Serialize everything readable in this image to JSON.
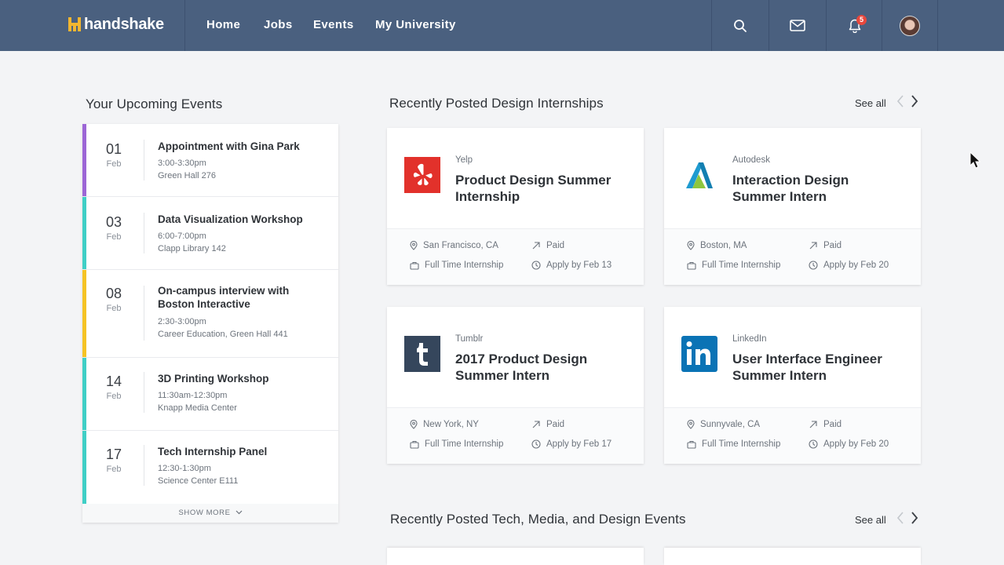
{
  "nav": {
    "brand": "handshake",
    "links": [
      "Home",
      "Jobs",
      "Events",
      "My University"
    ],
    "notification_count": "5",
    "icons": [
      "search-icon",
      "mail-icon",
      "bell-icon",
      "avatar"
    ]
  },
  "upcoming": {
    "title": "Your Upcoming Events",
    "events": [
      {
        "day": "01",
        "month": "Feb",
        "title": "Appointment with Gina Park",
        "time": "3:00-3:30pm",
        "location": "Green Hall 276",
        "color": "#9c66d6"
      },
      {
        "day": "03",
        "month": "Feb",
        "title": "Data Visualization Workshop",
        "time": "6:00-7:00pm",
        "location": "Clapp Library 142",
        "color": "#3fcfc6"
      },
      {
        "day": "08",
        "month": "Feb",
        "title": "On-campus interview with Boston Interactive",
        "time": "2:30-3:00pm",
        "location": "Career Education, Green Hall 441",
        "color": "#f5c324"
      },
      {
        "day": "14",
        "month": "Feb",
        "title": "3D Printing Workshop",
        "time": "11:30am-12:30pm",
        "location": "Knapp Media Center",
        "color": "#3fcfc6"
      },
      {
        "day": "17",
        "month": "Feb",
        "title": "Tech Internship Panel",
        "time": "12:30-1:30pm",
        "location": "Science Center E111",
        "color": "#3fcfc6"
      }
    ],
    "show_more": "SHOW MORE"
  },
  "internships": {
    "title": "Recently Posted Design Internships",
    "see_all": "See all",
    "cards": [
      {
        "company": "Yelp",
        "title": "Product Design Summer Internship",
        "location": "San Francisco, CA",
        "pay": "Paid",
        "type": "Full Time Internship",
        "deadline": "Apply by Feb 13",
        "logo": "yelp-logo",
        "logo_color": "#e2312b"
      },
      {
        "company": "Autodesk",
        "title": "Interaction Design Summer Intern",
        "location": "Boston, MA",
        "pay": "Paid",
        "type": "Full Time Internship",
        "deadline": "Apply by Feb 20",
        "logo": "autodesk-logo",
        "logo_color": "#1f9bd0"
      },
      {
        "company": "Tumblr",
        "title": "2017 Product Design Summer Intern",
        "location": "New York, NY",
        "pay": "Paid",
        "type": "Full Time Internship",
        "deadline": "Apply by Feb 17",
        "logo": "tumblr-logo",
        "logo_color": "#35465c"
      },
      {
        "company": "LinkedIn",
        "title": "User Interface Engineer Summer Intern",
        "location": "Sunnyvale, CA",
        "pay": "Paid",
        "type": "Full Time Internship",
        "deadline": "Apply by Feb 20",
        "logo": "linkedin-logo",
        "logo_color": "#0a73b5"
      }
    ]
  },
  "events_section": {
    "title": "Recently Posted Tech, Media, and Design Events",
    "see_all": "See all"
  }
}
